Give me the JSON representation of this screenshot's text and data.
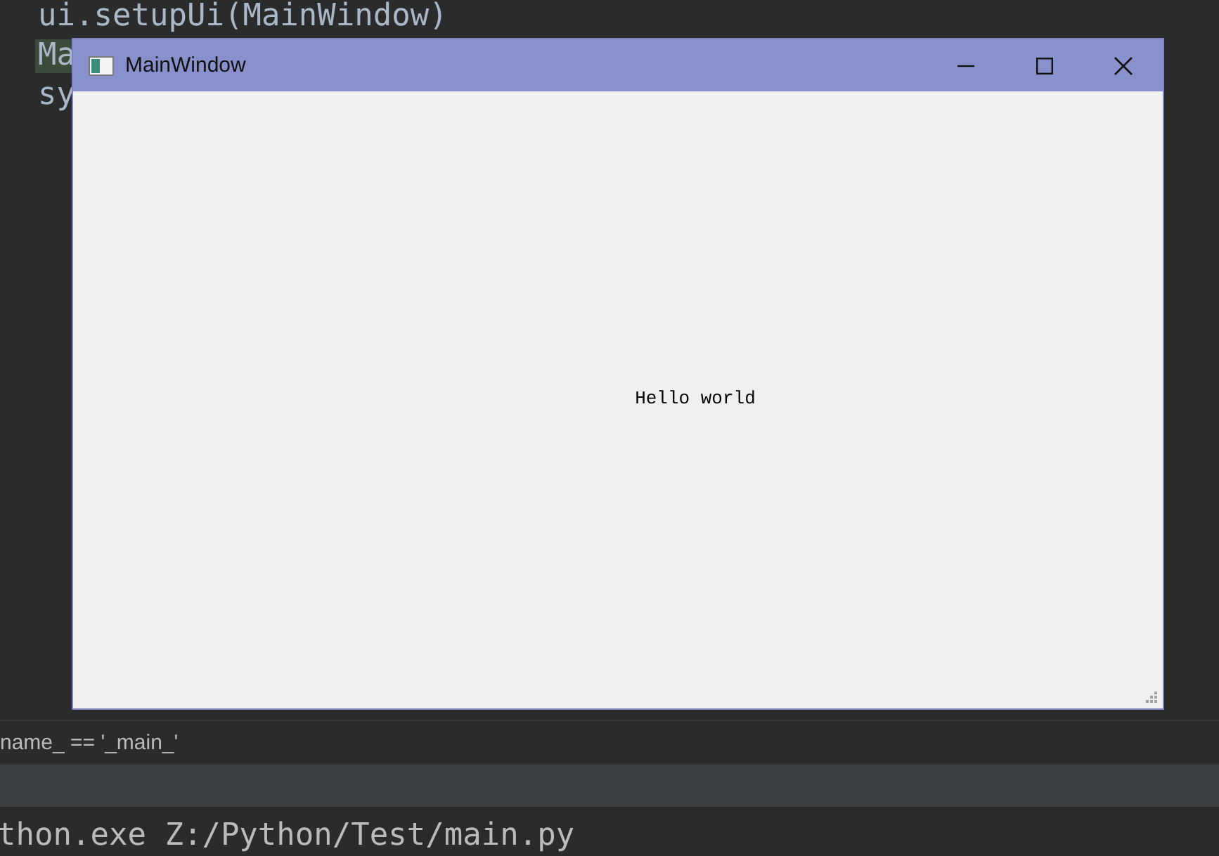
{
  "editor": {
    "code_lines": [
      {
        "text": "ui.setupUi(MainWindow)",
        "highlighted": false
      },
      {
        "text": "Ma",
        "highlighted": true
      },
      {
        "text": "sy",
        "highlighted": false
      }
    ],
    "breadcrumb": "name_ == '_main_'"
  },
  "window": {
    "title": "MainWindow",
    "label": "Hello world"
  },
  "console": {
    "line": "thon.exe Z:/Python/Test/main.py"
  }
}
